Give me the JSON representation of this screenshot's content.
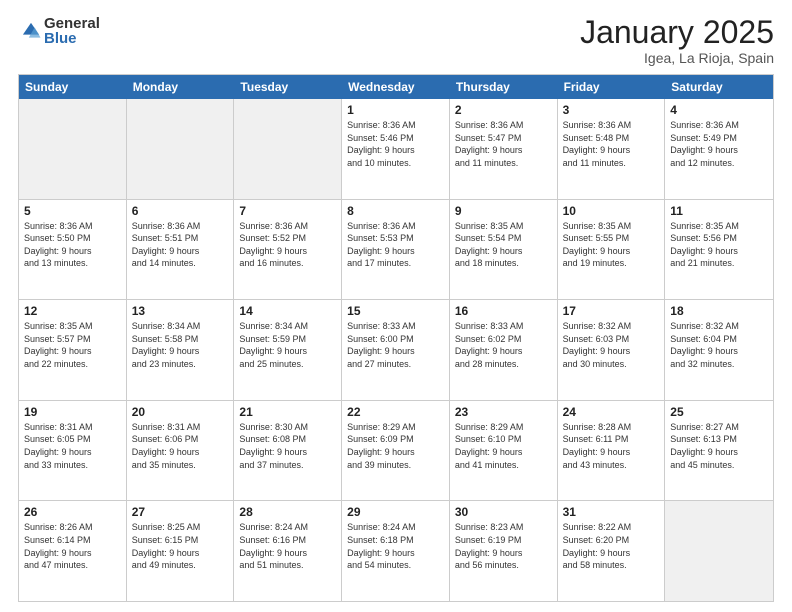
{
  "logo": {
    "general": "General",
    "blue": "Blue"
  },
  "title": "January 2025",
  "location": "Igea, La Rioja, Spain",
  "days_of_week": [
    "Sunday",
    "Monday",
    "Tuesday",
    "Wednesday",
    "Thursday",
    "Friday",
    "Saturday"
  ],
  "weeks": [
    [
      {
        "day": "",
        "detail": ""
      },
      {
        "day": "",
        "detail": ""
      },
      {
        "day": "",
        "detail": ""
      },
      {
        "day": "1",
        "detail": "Sunrise: 8:36 AM\nSunset: 5:46 PM\nDaylight: 9 hours\nand 10 minutes."
      },
      {
        "day": "2",
        "detail": "Sunrise: 8:36 AM\nSunset: 5:47 PM\nDaylight: 9 hours\nand 11 minutes."
      },
      {
        "day": "3",
        "detail": "Sunrise: 8:36 AM\nSunset: 5:48 PM\nDaylight: 9 hours\nand 11 minutes."
      },
      {
        "day": "4",
        "detail": "Sunrise: 8:36 AM\nSunset: 5:49 PM\nDaylight: 9 hours\nand 12 minutes."
      }
    ],
    [
      {
        "day": "5",
        "detail": "Sunrise: 8:36 AM\nSunset: 5:50 PM\nDaylight: 9 hours\nand 13 minutes."
      },
      {
        "day": "6",
        "detail": "Sunrise: 8:36 AM\nSunset: 5:51 PM\nDaylight: 9 hours\nand 14 minutes."
      },
      {
        "day": "7",
        "detail": "Sunrise: 8:36 AM\nSunset: 5:52 PM\nDaylight: 9 hours\nand 16 minutes."
      },
      {
        "day": "8",
        "detail": "Sunrise: 8:36 AM\nSunset: 5:53 PM\nDaylight: 9 hours\nand 17 minutes."
      },
      {
        "day": "9",
        "detail": "Sunrise: 8:35 AM\nSunset: 5:54 PM\nDaylight: 9 hours\nand 18 minutes."
      },
      {
        "day": "10",
        "detail": "Sunrise: 8:35 AM\nSunset: 5:55 PM\nDaylight: 9 hours\nand 19 minutes."
      },
      {
        "day": "11",
        "detail": "Sunrise: 8:35 AM\nSunset: 5:56 PM\nDaylight: 9 hours\nand 21 minutes."
      }
    ],
    [
      {
        "day": "12",
        "detail": "Sunrise: 8:35 AM\nSunset: 5:57 PM\nDaylight: 9 hours\nand 22 minutes."
      },
      {
        "day": "13",
        "detail": "Sunrise: 8:34 AM\nSunset: 5:58 PM\nDaylight: 9 hours\nand 23 minutes."
      },
      {
        "day": "14",
        "detail": "Sunrise: 8:34 AM\nSunset: 5:59 PM\nDaylight: 9 hours\nand 25 minutes."
      },
      {
        "day": "15",
        "detail": "Sunrise: 8:33 AM\nSunset: 6:00 PM\nDaylight: 9 hours\nand 27 minutes."
      },
      {
        "day": "16",
        "detail": "Sunrise: 8:33 AM\nSunset: 6:02 PM\nDaylight: 9 hours\nand 28 minutes."
      },
      {
        "day": "17",
        "detail": "Sunrise: 8:32 AM\nSunset: 6:03 PM\nDaylight: 9 hours\nand 30 minutes."
      },
      {
        "day": "18",
        "detail": "Sunrise: 8:32 AM\nSunset: 6:04 PM\nDaylight: 9 hours\nand 32 minutes."
      }
    ],
    [
      {
        "day": "19",
        "detail": "Sunrise: 8:31 AM\nSunset: 6:05 PM\nDaylight: 9 hours\nand 33 minutes."
      },
      {
        "day": "20",
        "detail": "Sunrise: 8:31 AM\nSunset: 6:06 PM\nDaylight: 9 hours\nand 35 minutes."
      },
      {
        "day": "21",
        "detail": "Sunrise: 8:30 AM\nSunset: 6:08 PM\nDaylight: 9 hours\nand 37 minutes."
      },
      {
        "day": "22",
        "detail": "Sunrise: 8:29 AM\nSunset: 6:09 PM\nDaylight: 9 hours\nand 39 minutes."
      },
      {
        "day": "23",
        "detail": "Sunrise: 8:29 AM\nSunset: 6:10 PM\nDaylight: 9 hours\nand 41 minutes."
      },
      {
        "day": "24",
        "detail": "Sunrise: 8:28 AM\nSunset: 6:11 PM\nDaylight: 9 hours\nand 43 minutes."
      },
      {
        "day": "25",
        "detail": "Sunrise: 8:27 AM\nSunset: 6:13 PM\nDaylight: 9 hours\nand 45 minutes."
      }
    ],
    [
      {
        "day": "26",
        "detail": "Sunrise: 8:26 AM\nSunset: 6:14 PM\nDaylight: 9 hours\nand 47 minutes."
      },
      {
        "day": "27",
        "detail": "Sunrise: 8:25 AM\nSunset: 6:15 PM\nDaylight: 9 hours\nand 49 minutes."
      },
      {
        "day": "28",
        "detail": "Sunrise: 8:24 AM\nSunset: 6:16 PM\nDaylight: 9 hours\nand 51 minutes."
      },
      {
        "day": "29",
        "detail": "Sunrise: 8:24 AM\nSunset: 6:18 PM\nDaylight: 9 hours\nand 54 minutes."
      },
      {
        "day": "30",
        "detail": "Sunrise: 8:23 AM\nSunset: 6:19 PM\nDaylight: 9 hours\nand 56 minutes."
      },
      {
        "day": "31",
        "detail": "Sunrise: 8:22 AM\nSunset: 6:20 PM\nDaylight: 9 hours\nand 58 minutes."
      },
      {
        "day": "",
        "detail": ""
      }
    ]
  ]
}
